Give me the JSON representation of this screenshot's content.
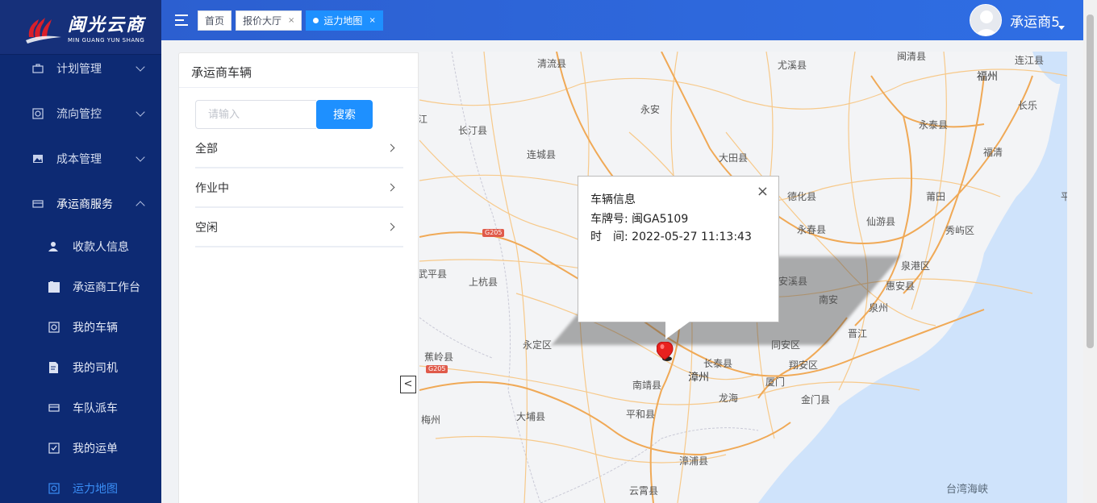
{
  "brand": {
    "name_cn": "闽光云商",
    "name_en": "MIN GUANG YUN SHANG"
  },
  "sidebar": {
    "menus": [
      {
        "label": "计划管理",
        "icon": "briefcase-icon",
        "open": false
      },
      {
        "label": "流向管控",
        "icon": "target-icon",
        "open": false
      },
      {
        "label": "成本管理",
        "icon": "image-icon",
        "open": false
      },
      {
        "label": "承运商服务",
        "icon": "truck-icon",
        "open": true
      }
    ],
    "sub_items": [
      {
        "label": "收款人信息",
        "icon": "user-icon"
      },
      {
        "label": "承运商工作台",
        "icon": "folder-icon"
      },
      {
        "label": "我的车辆",
        "icon": "vehicle-icon"
      },
      {
        "label": "我的司机",
        "icon": "driver-doc-icon"
      },
      {
        "label": "车队派车",
        "icon": "dispatch-icon"
      },
      {
        "label": "我的运单",
        "icon": "checkbox-icon"
      },
      {
        "label": "运力地图",
        "icon": "map-icon",
        "active": true
      }
    ]
  },
  "tabs": [
    {
      "label": "首页",
      "closable": false,
      "active": false
    },
    {
      "label": "报价大厅",
      "closable": true,
      "active": false
    },
    {
      "label": "运力地图",
      "closable": true,
      "active": true
    }
  ],
  "tab_close_glyph": "×",
  "user": {
    "name": "承运商5"
  },
  "panel": {
    "title": "承运商车辆",
    "search_placeholder": "请输入",
    "search_button": "搜索",
    "filters": [
      "全部",
      "作业中",
      "空闲"
    ]
  },
  "collapse_glyph": "<",
  "info_window": {
    "title": "车辆信息",
    "plate_label": "车牌号:",
    "plate_value": "闽GA5109",
    "time_label": "时　间:",
    "time_value": "2022-05-27 11:13:43",
    "close_glyph": "×"
  },
  "map_labels": {
    "qingliu": "清流县",
    "youxi": "尤溪县",
    "minqing": "闽清县",
    "lianjiang": "连江县",
    "fuzhou": "福州",
    "changle": "长乐",
    "yongan": "永安",
    "changting": "长汀县",
    "yongtai": "永泰县",
    "liancheng": "连城县",
    "datian": "大田县",
    "fuqing": "福清",
    "dehua": "德化县",
    "putian": "莆田",
    "ping": "平",
    "yongchun": "永春县",
    "xianyou": "仙游县",
    "xiuyu": "秀屿区",
    "quangang": "泉港区",
    "anxi": "安溪县",
    "huian": "惠安县",
    "nanan": "南安",
    "quanzhou": "泉州",
    "shanghang": "上杭县",
    "wuping": "武平县",
    "jinjiang": "晋江",
    "yongding": "永定区",
    "tongan": "同安区",
    "changtai": "长泰县",
    "jiaoling": "蕉岭县",
    "zhangzhou": "漳州",
    "xiangan": "翔安区",
    "nanjing": "南靖县",
    "xiamen": "厦门",
    "longhai": "龙海",
    "jinmen": "金门县",
    "meizhou": "梅州",
    "pinghe": "平和县",
    "dapu": "大埔县",
    "zhangpu": "漳浦县",
    "yunxiao": "云霄县",
    "taiwan_strait": "台湾海峡",
    "jiang": "江",
    "g205a": "G205",
    "g205b": "G205"
  }
}
